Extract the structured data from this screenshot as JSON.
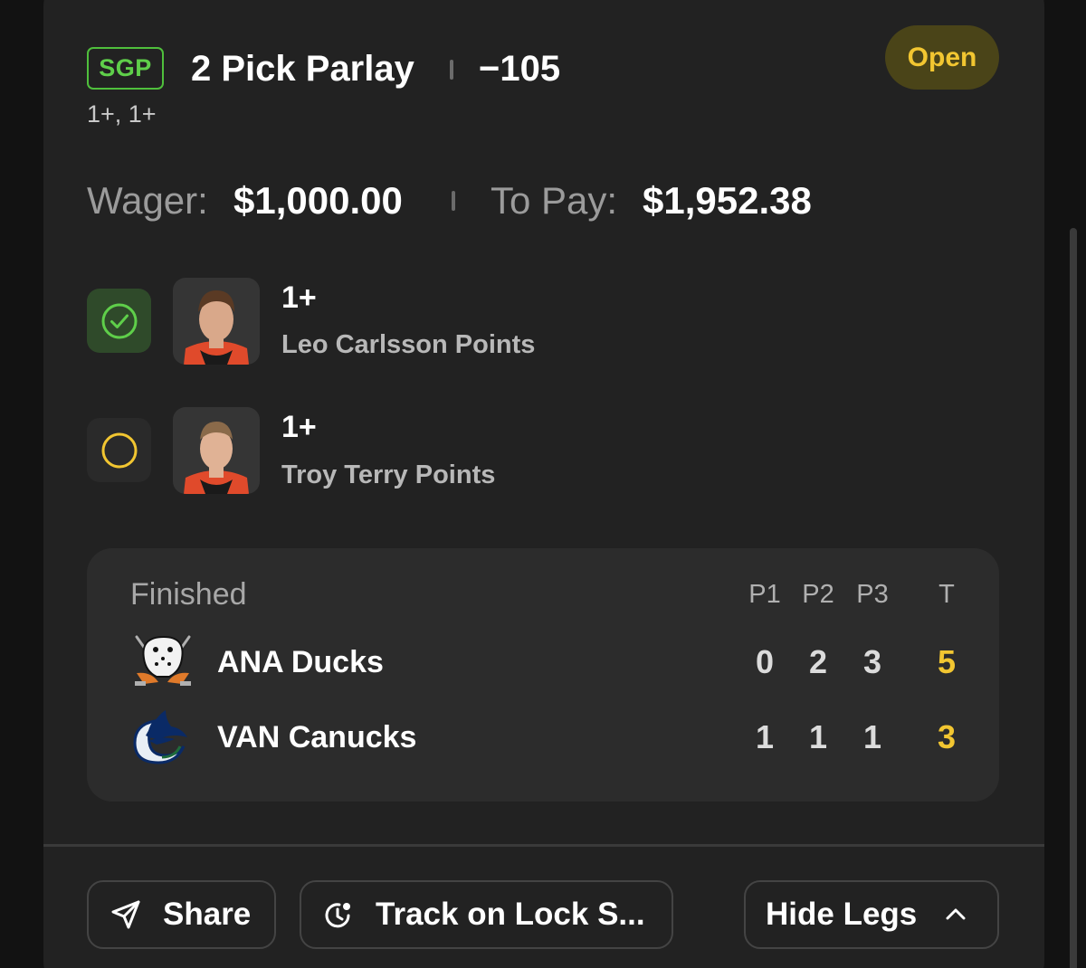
{
  "header": {
    "badge": "SGP",
    "title": "2 Pick Parlay",
    "odds": "−105",
    "subtitle": "1+, 1+",
    "status": "Open"
  },
  "wager": {
    "wager_label": "Wager:",
    "wager_value": "$1,000.00",
    "pay_label": "To Pay:",
    "pay_value": "$1,952.38"
  },
  "legs": [
    {
      "line": "1+",
      "market": "Leo Carlsson Points",
      "status": "won"
    },
    {
      "line": "1+",
      "market": "Troy Terry Points",
      "status": "pending"
    }
  ],
  "game": {
    "state": "Finished",
    "periods": [
      "P1",
      "P2",
      "P3",
      "T"
    ],
    "teams": [
      {
        "name": "ANA Ducks",
        "logo": "ducks-logo",
        "scores": [
          "0",
          "2",
          "3"
        ],
        "total": "5"
      },
      {
        "name": "VAN Canucks",
        "logo": "canucks-logo",
        "scores": [
          "1",
          "1",
          "1"
        ],
        "total": "3"
      }
    ]
  },
  "actions": {
    "share": "Share",
    "track": "Track on Lock S...",
    "hide_legs": "Hide Legs"
  },
  "colors": {
    "accent_green": "#5fcf4a",
    "accent_yellow": "#f2c631",
    "card_bg": "#222222"
  }
}
